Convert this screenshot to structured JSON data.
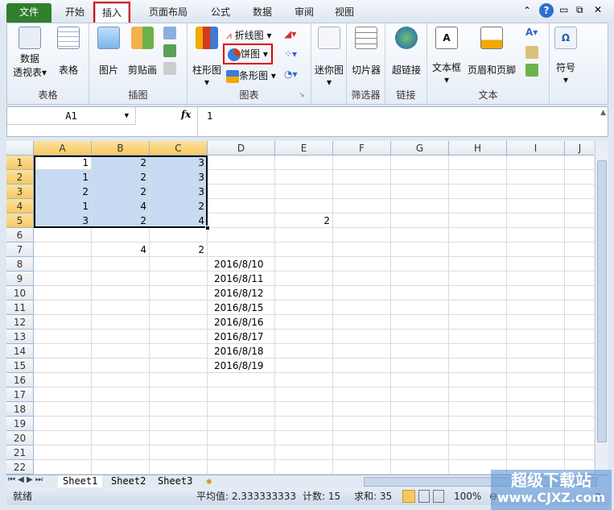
{
  "tabs": [
    "文件",
    "开始",
    "插入",
    "页面布局",
    "公式",
    "数据",
    "审阅",
    "视图"
  ],
  "ribbon": {
    "groups": {
      "table": "表格",
      "illustrations": "插图",
      "charts": "图表",
      "filter": "筛选器",
      "links": "链接",
      "text": "文本"
    },
    "pivot": "数据",
    "pivot2": "透视表",
    "table": "表格",
    "picture": "图片",
    "clipart": "剪贴画",
    "column": "柱形图",
    "line": "折线图",
    "pie": "饼图",
    "bar": "条形图",
    "sparkline": "迷你图",
    "slicer": "切片器",
    "hyperlink": "超链接",
    "textbox": "文本框",
    "header_footer": "页眉和页脚",
    "symbol": "符号"
  },
  "formula_bar": {
    "name_box": "A1",
    "fx": "fx",
    "value": "1"
  },
  "columns": [
    "A",
    "B",
    "C",
    "D",
    "E",
    "F",
    "G",
    "H",
    "I",
    "J"
  ],
  "rows": [
    "1",
    "2",
    "3",
    "4",
    "5",
    "6",
    "7",
    "8",
    "9",
    "10",
    "11",
    "12",
    "13",
    "14",
    "15",
    "16",
    "17",
    "18",
    "19",
    "20",
    "21",
    "22"
  ],
  "cells": {
    "A1": "1",
    "B1": "2",
    "C1": "3",
    "A2": "1",
    "B2": "2",
    "C2": "3",
    "A3": "2",
    "B3": "2",
    "C3": "3",
    "A4": "1",
    "B4": "4",
    "C4": "2",
    "A5": "3",
    "B5": "2",
    "C5": "4",
    "E5": "2",
    "B7": "4",
    "C7": "2",
    "D8": "2016/8/10",
    "D9": "2016/8/11",
    "D10": "2016/8/12",
    "D11": "2016/8/15",
    "D12": "2016/8/16",
    "D13": "2016/8/17",
    "D14": "2016/8/18",
    "D15": "2016/8/19"
  },
  "sheets": [
    "Sheet1",
    "Sheet2",
    "Sheet3"
  ],
  "status": {
    "ready": "就绪",
    "average": "平均值: 2.333333333",
    "count": "计数: 15",
    "sum": "求和: 35",
    "zoom": "100%"
  },
  "watermark": {
    "line1": "超级下载站",
    "line2": "www.CJXZ.com"
  },
  "colors": {
    "file_tab": "#2f7f2f",
    "highlight": "#e00000",
    "selection": "#c6dbf3"
  }
}
